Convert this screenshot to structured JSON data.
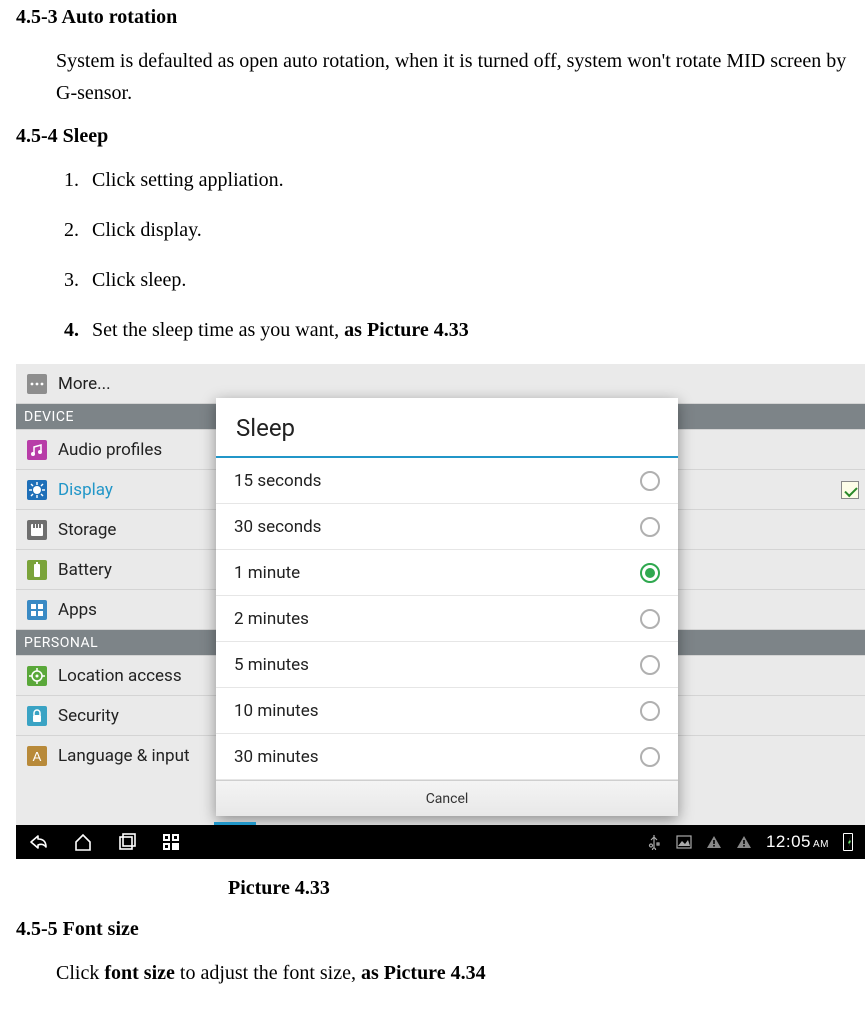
{
  "doc": {
    "s453_title": "4.5-3 Auto rotation",
    "s453_body": "System is defaulted as open auto rotation, when it is turned off, system won't rotate MID screen by G-sensor.",
    "s454_title": "4.5-4 Sleep",
    "s454_steps": [
      {
        "num": "1.",
        "text": "Click setting appliation."
      },
      {
        "num": "2.",
        "text": "Click display."
      },
      {
        "num": "3.",
        "text": "Click sleep."
      },
      {
        "num": "4.",
        "prefix": "Set the sleep time as you want, ",
        "bold": "as Picture 4.33"
      }
    ],
    "caption_433": "Picture 4.33",
    "s455_title": "4.5-5 Font size",
    "s455_prefix": "Click ",
    "s455_bold1": "font size",
    "s455_mid": " to adjust the font size, ",
    "s455_bold2": "as Picture 4.34"
  },
  "screenshot": {
    "settings_rows": [
      {
        "type": "item",
        "icon": "more",
        "label": "More..."
      },
      {
        "type": "section",
        "label": "DEVICE"
      },
      {
        "type": "item",
        "icon": "audio",
        "label": "Audio profiles"
      },
      {
        "type": "item",
        "icon": "display",
        "label": "Display",
        "selected": true,
        "checked": true
      },
      {
        "type": "item",
        "icon": "storage",
        "label": "Storage"
      },
      {
        "type": "item",
        "icon": "battery",
        "label": "Battery"
      },
      {
        "type": "item",
        "icon": "apps",
        "label": "Apps"
      },
      {
        "type": "section",
        "label": "PERSONAL"
      },
      {
        "type": "item",
        "icon": "location",
        "label": "Location access"
      },
      {
        "type": "item",
        "icon": "security",
        "label": "Security"
      },
      {
        "type": "item",
        "icon": "language",
        "label": "Language & input"
      }
    ],
    "dialog": {
      "title": "Sleep",
      "options": [
        {
          "label": "15 seconds",
          "selected": false
        },
        {
          "label": "30 seconds",
          "selected": false
        },
        {
          "label": "1 minute",
          "selected": true
        },
        {
          "label": "2 minutes",
          "selected": false
        },
        {
          "label": "5 minutes",
          "selected": false
        },
        {
          "label": "10 minutes",
          "selected": false
        },
        {
          "label": "30 minutes",
          "selected": false
        }
      ],
      "cancel": "Cancel"
    },
    "statusbar": {
      "time": "12:05",
      "ampm": "AM"
    }
  }
}
